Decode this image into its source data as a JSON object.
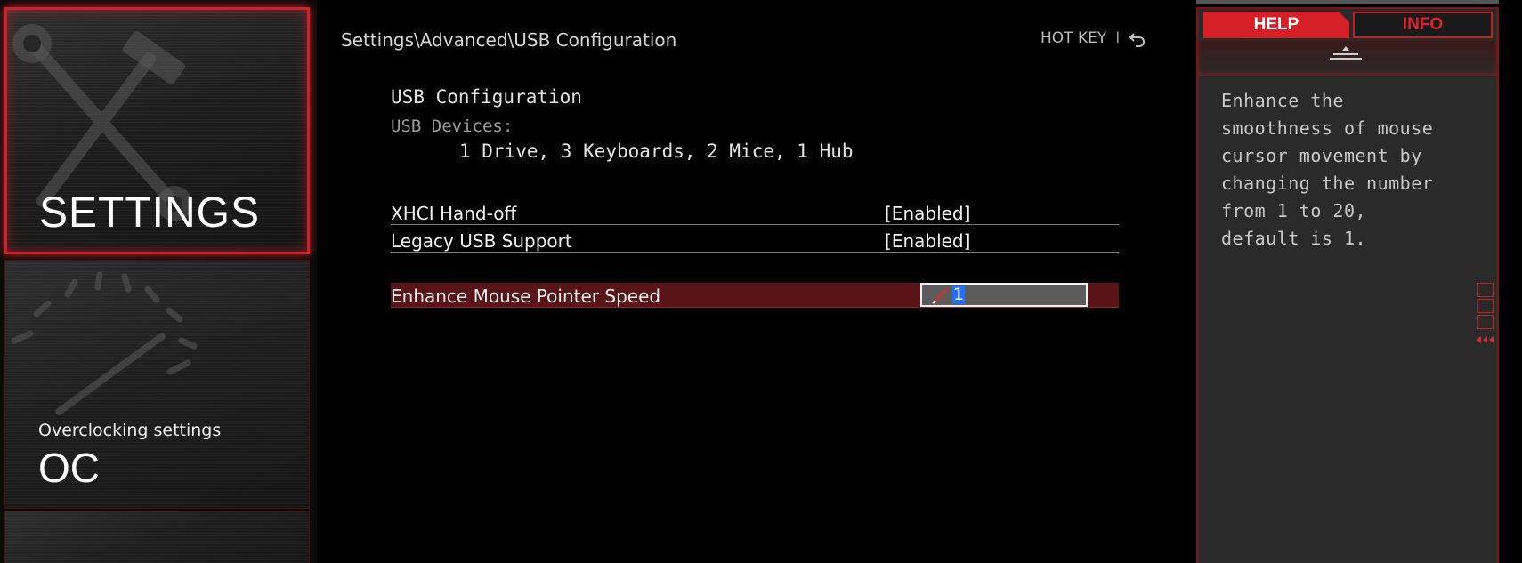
{
  "colors": {
    "accent": "#d71f28",
    "selected_row": "#5a1317",
    "panel_bg": "#2a2a2a",
    "input_highlight": "#1f6fff"
  },
  "sidebar": {
    "tiles": [
      {
        "id": "settings",
        "title": "SETTINGS",
        "active": true,
        "watermark_icon": "wrench-hammer-icon"
      },
      {
        "id": "oc",
        "subtitle": "Overclocking settings",
        "title": "OC",
        "active": false,
        "watermark_icon": "gauge-icon"
      }
    ]
  },
  "main": {
    "breadcrumb": "Settings\\Advanced\\USB Configuration",
    "hotkey": {
      "label": "HOT KEY",
      "separator": "I",
      "back_icon": "back-arrow-icon"
    },
    "section_title": "USB Configuration",
    "devices_label": "USB Devices:",
    "devices_value": "1 Drive, 3 Keyboards, 2 Mice, 1 Hub",
    "options": [
      {
        "label": "XHCI Hand-off",
        "value": "[Enabled]"
      },
      {
        "label": "Legacy USB Support",
        "value": "[Enabled]"
      },
      {
        "label": "Enhance Mouse Pointer Speed",
        "value": "1",
        "selected": true,
        "editing": true
      }
    ]
  },
  "help_panel": {
    "tabs": [
      {
        "label": "HELP",
        "active": true
      },
      {
        "label": "INFO",
        "active": false
      }
    ],
    "lines": [
      "Enhance the",
      "smoothness of mouse",
      "cursor movement by",
      "changing the number",
      "from 1 to 20,",
      "default is 1."
    ]
  }
}
